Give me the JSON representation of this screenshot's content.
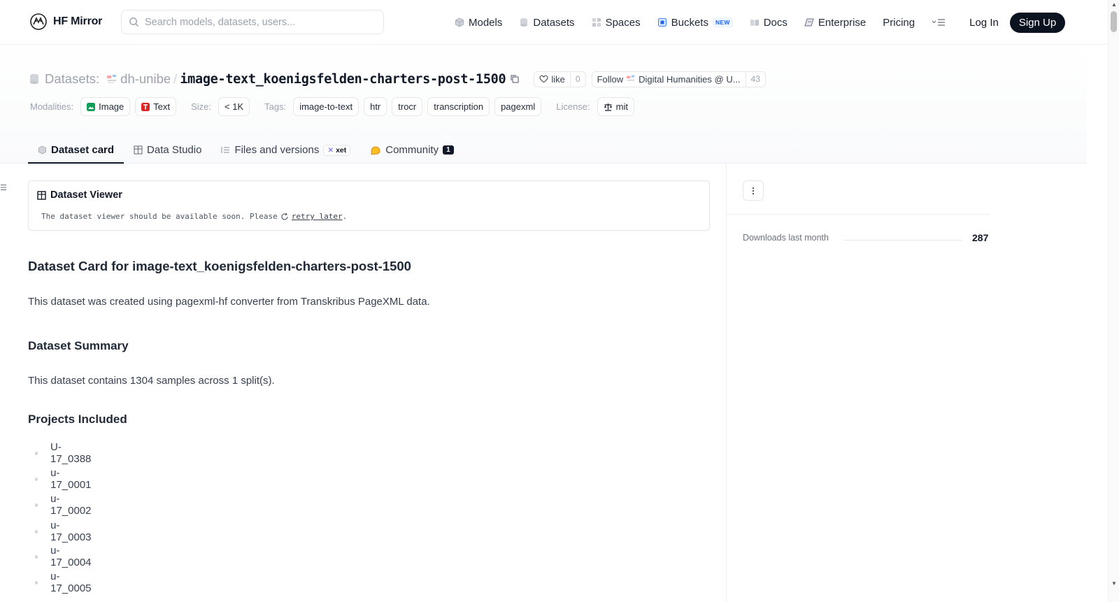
{
  "header": {
    "logo_text": "HF Mirror",
    "search_placeholder": "Search models, datasets, users...",
    "nav": [
      {
        "label": "Models",
        "icon": "cube-icon"
      },
      {
        "label": "Datasets",
        "icon": "database-icon"
      },
      {
        "label": "Spaces",
        "icon": "grid-icon"
      },
      {
        "label": "Buckets",
        "icon": "bucket-icon",
        "badge": "NEW"
      },
      {
        "label": "Docs",
        "icon": "book-icon"
      },
      {
        "label": "Enterprise",
        "icon": "enterprise-icon"
      },
      {
        "label": "Pricing"
      }
    ],
    "login": "Log In",
    "signup": "Sign Up"
  },
  "repo": {
    "type_label": "Datasets:",
    "org": "dh-unibe",
    "slash": "/",
    "name": "image-text_koenigsfelden-charters-post-1500",
    "like_label": "like",
    "like_count": "0",
    "follow_label": "Follow",
    "follow_org": "Digital Humanities @ U...",
    "follow_count": "43",
    "modalities_label": "Modalities:",
    "modalities": [
      "Image",
      "Text"
    ],
    "size_label": "Size:",
    "size": "< 1K",
    "tags_label": "Tags:",
    "tags": [
      "image-to-text",
      "htr",
      "trocr",
      "transcription",
      "pagexml"
    ],
    "license_label": "License:",
    "license": "mit"
  },
  "tabs": [
    {
      "label": "Dataset card",
      "active": true
    },
    {
      "label": "Data Studio"
    },
    {
      "label": "Files and versions",
      "badge": "xet"
    },
    {
      "label": "Community",
      "count": "1"
    }
  ],
  "viewer": {
    "title": "Dataset Viewer",
    "message": "The dataset viewer should be available soon. Please",
    "link": "retry later",
    "suffix": "."
  },
  "card": {
    "title": "Dataset Card for image-text_koenigsfelden-charters-post-1500",
    "intro": "This dataset was created using pagexml-hf converter from Transkribus PageXML data.",
    "summary_heading": "Dataset Summary",
    "summary_text": "This dataset contains 1304 samples across 1 split(s).",
    "projects_heading": "Projects Included",
    "projects": [
      "U-17_0388",
      "u-17_0001",
      "u-17_0002",
      "u-17_0003",
      "u-17_0004",
      "u-17_0005"
    ]
  },
  "sidebar": {
    "downloads_label": "Downloads last month",
    "downloads_value": "287"
  },
  "colors": {
    "signup_bg": "#0b1220",
    "new_badge": "#2563eb",
    "image_modality": "#0f9d58",
    "text_modality": "#dc2626",
    "community_icon": "#fbbf24"
  }
}
